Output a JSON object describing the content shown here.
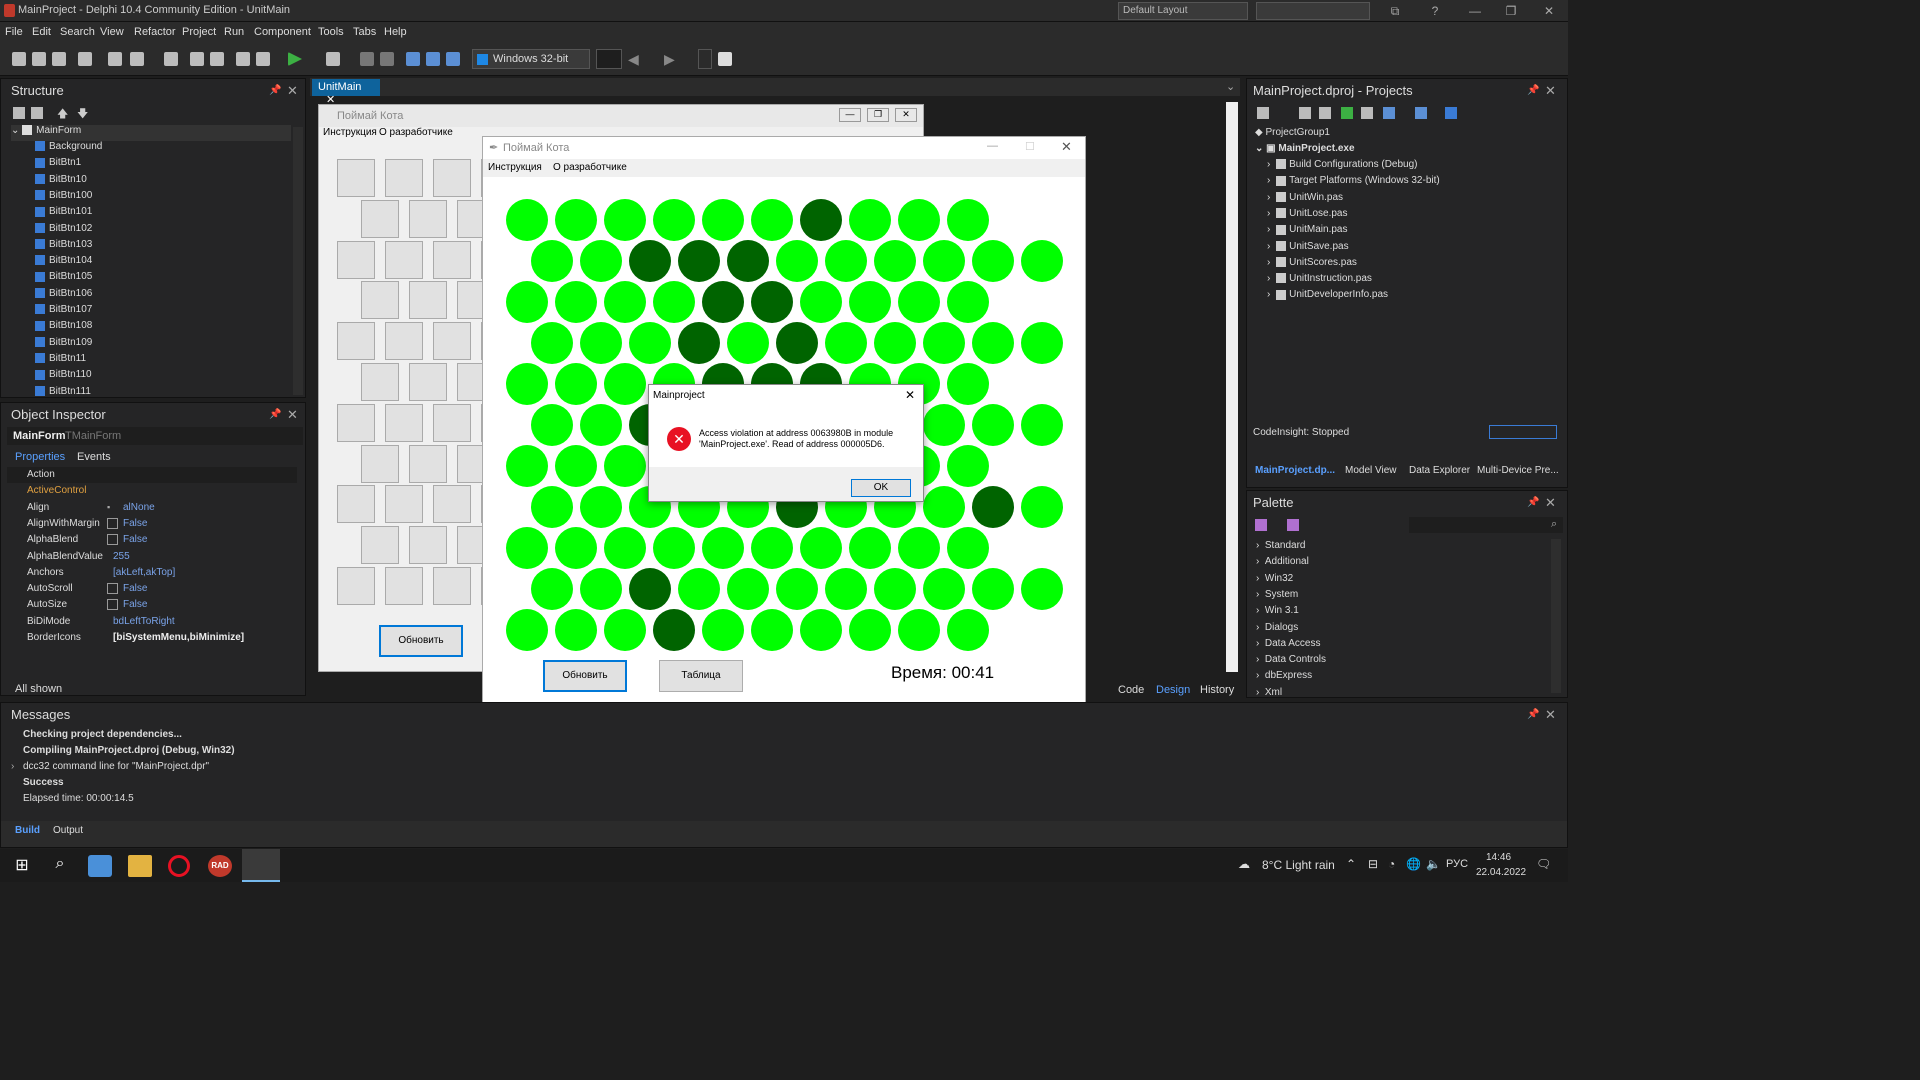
{
  "titlebar": {
    "title": "MainProject - Delphi 10.4 Community Edition - UnitMain",
    "layout": "Default Layout"
  },
  "menu": [
    "File",
    "Edit",
    "Search",
    "View",
    "Refactor",
    "Project",
    "Run",
    "Component",
    "Tools",
    "Tabs",
    "Help"
  ],
  "toolbar": {
    "platform": "Windows 32-bit"
  },
  "structure": {
    "title": "Structure",
    "root": "MainForm",
    "items": [
      "Background",
      "BitBtn1",
      "BitBtn10",
      "BitBtn100",
      "BitBtn101",
      "BitBtn102",
      "BitBtn103",
      "BitBtn104",
      "BitBtn105",
      "BitBtn106",
      "BitBtn107",
      "BitBtn108",
      "BitBtn109",
      "BitBtn11",
      "BitBtn110",
      "BitBtn111"
    ]
  },
  "inspector": {
    "title": "Object Inspector",
    "object": "MainForm",
    "class": "TMainForm",
    "tabs": [
      "Properties",
      "Events"
    ],
    "rows": [
      {
        "k": "Action",
        "v": ""
      },
      {
        "k": "ActiveControl",
        "v": ""
      },
      {
        "k": "Align",
        "v": "alNone"
      },
      {
        "k": "AlignWithMargin",
        "v": "False"
      },
      {
        "k": "AlphaBlend",
        "v": "False"
      },
      {
        "k": "AlphaBlendValue",
        "v": "255"
      },
      {
        "k": "Anchors",
        "v": "[akLeft,akTop]"
      },
      {
        "k": "AutoScroll",
        "v": "False"
      },
      {
        "k": "AutoSize",
        "v": "False"
      },
      {
        "k": "BiDiMode",
        "v": "bdLeftToRight"
      },
      {
        "k": "BorderIcons",
        "v": "[biSystemMenu,biMinimize]"
      }
    ],
    "footer": "All shown"
  },
  "editor": {
    "tab": "UnitMain",
    "bottom_tabs": [
      "Code",
      "Design",
      "History"
    ]
  },
  "designer_form": {
    "title": "Поймай Кота",
    "menu": [
      "Инструкция",
      "О разработчике"
    ],
    "refresh": "Обновить"
  },
  "game": {
    "title": "Поймай Кота",
    "menu": [
      "Инструкция",
      "О разработчике"
    ],
    "refresh": "Обновить",
    "records": "Таблица рекордов",
    "timer": "Время: 00:41",
    "colors": {
      "light": "#00ff00",
      "dark": "#006400",
      "mid": "#00cc00"
    }
  },
  "dialog": {
    "title": "Mainproject",
    "message_line1": "Access violation at address 0063980B in module",
    "message_line2": "'MainProject.exe'. Read of address 000005D6.",
    "ok": "OK"
  },
  "projects": {
    "title": "MainProject.dproj - Projects",
    "group": "ProjectGroup1",
    "exe": "MainProject.exe",
    "items": [
      "Build Configurations (Debug)",
      "Target Platforms (Windows 32-bit)",
      "UnitWin.pas",
      "UnitLose.pas",
      "UnitMain.pas",
      "UnitSave.pas",
      "UnitScores.pas",
      "UnitInstruction.pas",
      "UnitDeveloperInfo.pas"
    ],
    "codeinsight": "CodeInsight: Stopped",
    "tabs": [
      "MainProject.dp...",
      "Model View",
      "Data Explorer",
      "Multi-Device Pre..."
    ]
  },
  "palette": {
    "title": "Palette",
    "items": [
      "Standard",
      "Additional",
      "Win32",
      "System",
      "Win 3.1",
      "Dialogs",
      "Data Access",
      "Data Controls",
      "dbExpress",
      "Xml"
    ]
  },
  "messages": {
    "title": "Messages",
    "lines": [
      "Checking project dependencies...",
      "Compiling MainProject.dproj (Debug, Win32)",
      "dcc32 command line for \"MainProject.dpr\"",
      "Success",
      "Elapsed time: 00:00:14.5"
    ],
    "tabs": [
      "Build",
      "Output"
    ]
  },
  "taskbar": {
    "weather": "8°C  Light rain",
    "lang": "РУС",
    "time": "14:46",
    "date": "22.04.2022"
  }
}
